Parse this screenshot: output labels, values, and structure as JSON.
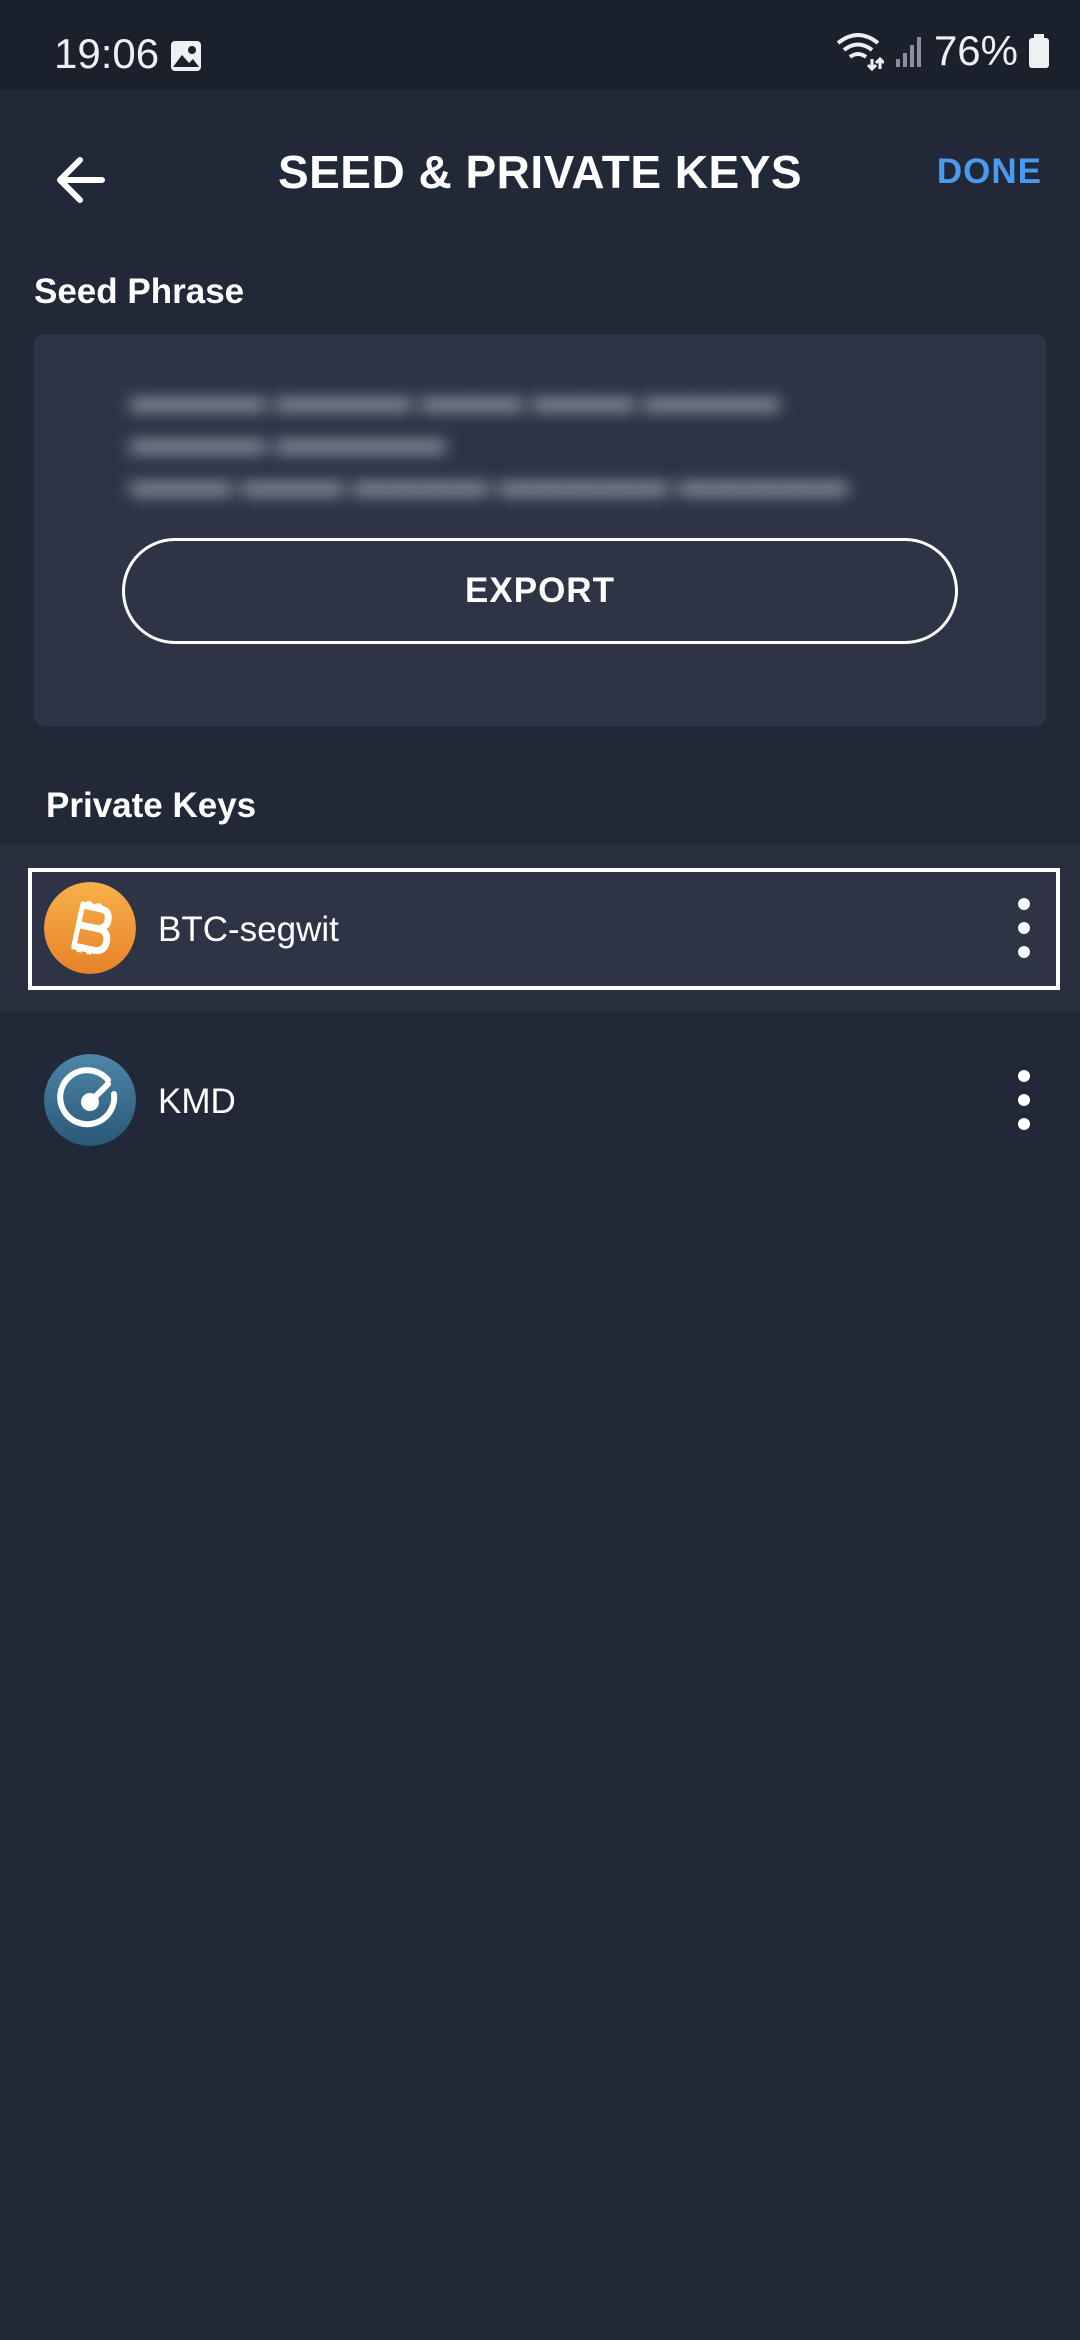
{
  "status_bar": {
    "time": "19:06",
    "battery": "76%",
    "icons": [
      "gallery-icon",
      "wifi-icon",
      "signal-icon",
      "battery-icon"
    ]
  },
  "header": {
    "title": "SEED & PRIVATE KEYS",
    "done_label": "DONE",
    "back_icon": "arrow-left-icon"
  },
  "seed_section": {
    "label": "Seed Phrase",
    "export_label": "EXPORT"
  },
  "private_keys": {
    "label": "Private Keys",
    "items": [
      {
        "name": "BTC-segwit",
        "icon": "bitcoin-icon",
        "selected": true
      },
      {
        "name": "KMD",
        "icon": "komodo-icon",
        "selected": false
      }
    ]
  },
  "colors": {
    "background": "#212838",
    "card": "#2c3446",
    "accent": "#4a9af0",
    "bitcoin": "#f2a53c",
    "komodo": "#3a6f8f"
  }
}
